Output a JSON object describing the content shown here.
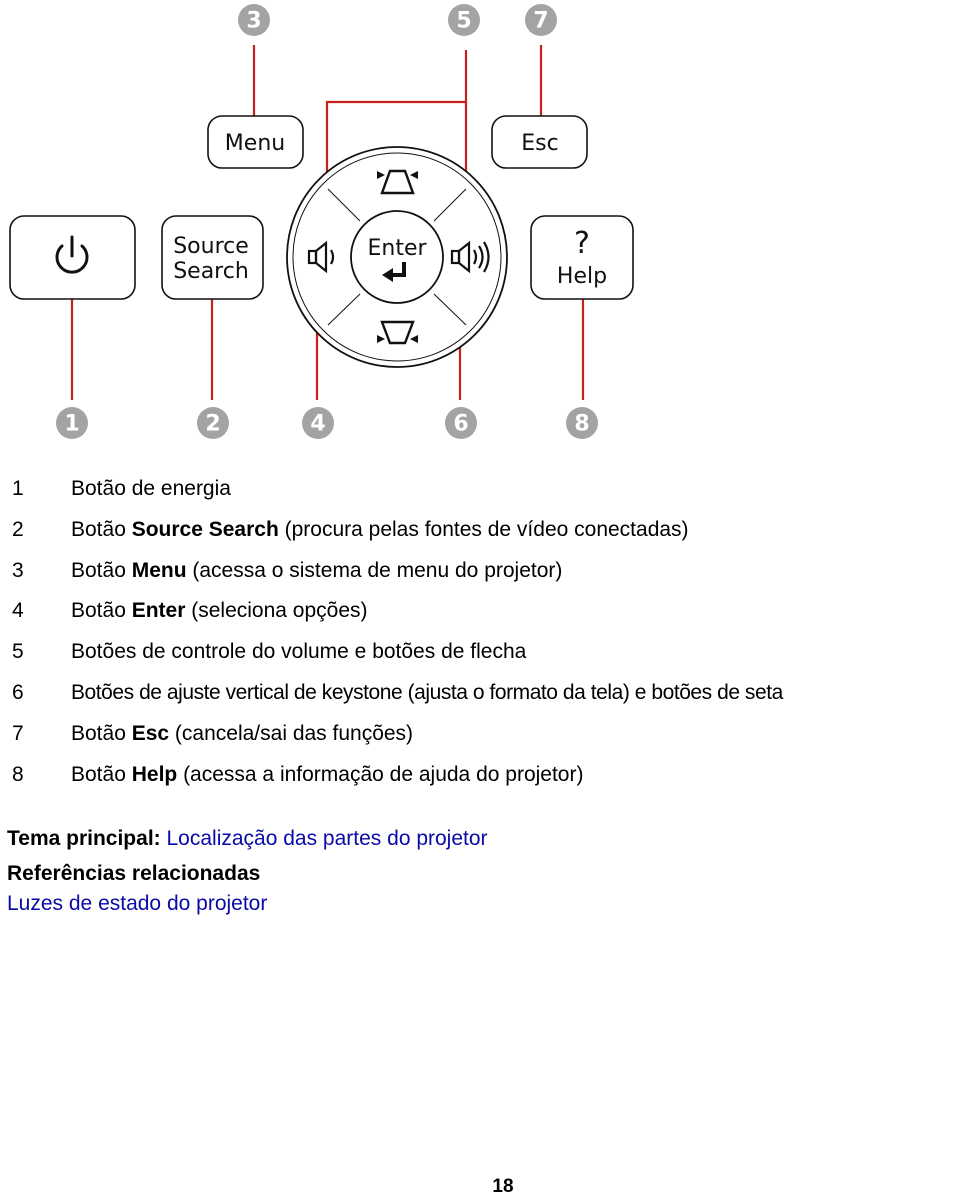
{
  "diagram": {
    "buttons": {
      "power": {
        "icon": "power-icon"
      },
      "source_search": {
        "line1": "Source",
        "line2": "Search"
      },
      "menu": {
        "label": "Menu"
      },
      "enter": {
        "label": "Enter",
        "icon": "return-arrow-icon"
      },
      "esc": {
        "label": "Esc"
      },
      "help": {
        "symbol": "?",
        "label": "Help"
      },
      "volume_down": {
        "icon": "speaker-low-icon"
      },
      "volume_up": {
        "icon": "speaker-high-icon"
      },
      "keystone_up": {
        "icon": "keystone-up-icon"
      },
      "keystone_down": {
        "icon": "keystone-down-icon"
      }
    },
    "callouts": [
      "1",
      "2",
      "3",
      "4",
      "5",
      "6",
      "7",
      "8"
    ],
    "colors": {
      "callout_fill": "#a3a3a3",
      "leader_line": "#c8201e",
      "outline": "#111111"
    }
  },
  "legend": [
    {
      "num": "1",
      "pre": "Botão de energia",
      "bold": "",
      "post": ""
    },
    {
      "num": "2",
      "pre": "Botão ",
      "bold": "Source Search",
      "post": " (procura pelas fontes de vídeo conectadas)"
    },
    {
      "num": "3",
      "pre": "Botão ",
      "bold": "Menu",
      "post": " (acessa o sistema de menu do projetor)"
    },
    {
      "num": "4",
      "pre": "Botão ",
      "bold": "Enter",
      "post": " (seleciona opções)"
    },
    {
      "num": "5",
      "pre": "Botões de controle do volume e botões de flecha",
      "bold": "",
      "post": ""
    },
    {
      "num": "6",
      "pre": "Botões de ajuste vertical de keystone (ajusta o formato da tela) e botões de seta",
      "bold": "",
      "post": ""
    },
    {
      "num": "7",
      "pre": "Botão ",
      "bold": "Esc",
      "post": " (cancela/sai das funções)"
    },
    {
      "num": "8",
      "pre": "Botão ",
      "bold": "Help",
      "post": " (acessa a informação de ajuda do projetor)"
    }
  ],
  "footer": {
    "parent_topic_label": "Tema principal:",
    "parent_topic_link": "Localização das partes do projetor",
    "related_heading": "Referências relacionadas",
    "related_link": "Luzes de estado do projetor",
    "link_color": "#0a0aa8"
  },
  "page_number": "18"
}
